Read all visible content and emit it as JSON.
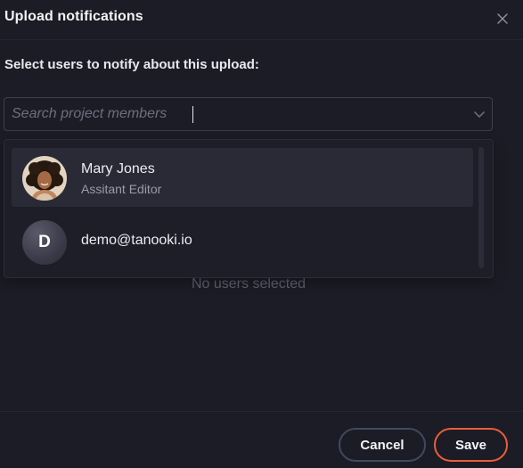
{
  "dialog": {
    "title": "Upload notifications",
    "close_icon": "close-icon"
  },
  "prompt": "Select users to notify about this upload:",
  "search": {
    "placeholder": "Search project members",
    "value": "",
    "chevron_icon": "chevron-down-icon"
  },
  "options": [
    {
      "name": "Mary Jones",
      "role": "Assitant Editor",
      "avatar": "photo-avatar"
    },
    {
      "name": "demo@tanooki.io",
      "avatar_letter": "D"
    }
  ],
  "empty_state": "No users selected",
  "footer": {
    "cancel_label": "Cancel",
    "save_label": "Save"
  },
  "colors": {
    "background": "#1c1c26",
    "accent": "#ea5e3a",
    "cancel_border": "#3f4a5e"
  }
}
